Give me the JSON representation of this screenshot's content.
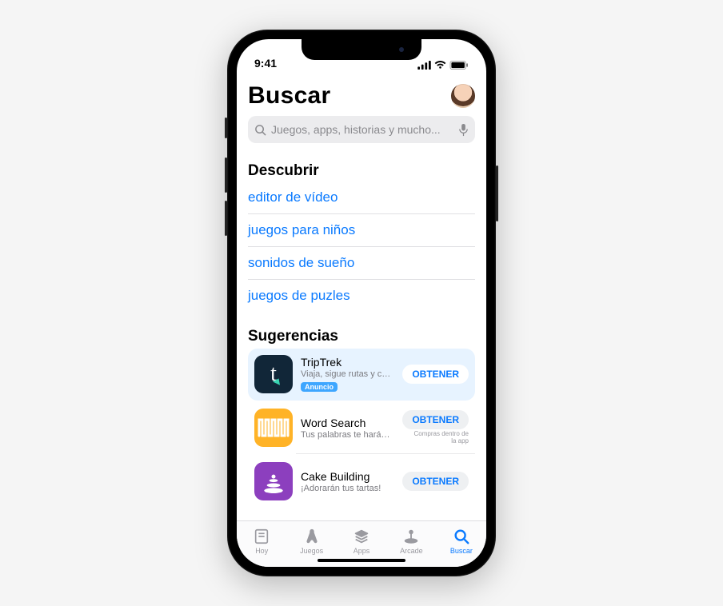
{
  "status": {
    "time": "9:41"
  },
  "header": {
    "title": "Buscar"
  },
  "search": {
    "placeholder": "Juegos, apps, historias y mucho..."
  },
  "discover": {
    "heading": "Descubrir",
    "items": [
      "editor de vídeo",
      "juegos para niños",
      "sonidos de sueño",
      "juegos de puzles"
    ]
  },
  "suggestions": {
    "heading": "Sugerencias",
    "get_label": "OBTENER",
    "ad_label": "Anuncio",
    "iap_label": "Compras dentro de la app",
    "apps": [
      {
        "name": "TripTrek",
        "subtitle": "Viaja, sigue rutas y comparte.",
        "promoted": true
      },
      {
        "name": "Word Search",
        "subtitle": "Tus palabras te harán ganar.",
        "iap": true
      },
      {
        "name": "Cake Building",
        "subtitle": "¡Adorarán tus tartas!"
      }
    ]
  },
  "tabs": {
    "today": "Hoy",
    "games": "Juegos",
    "apps": "Apps",
    "arcade": "Arcade",
    "search": "Buscar"
  }
}
